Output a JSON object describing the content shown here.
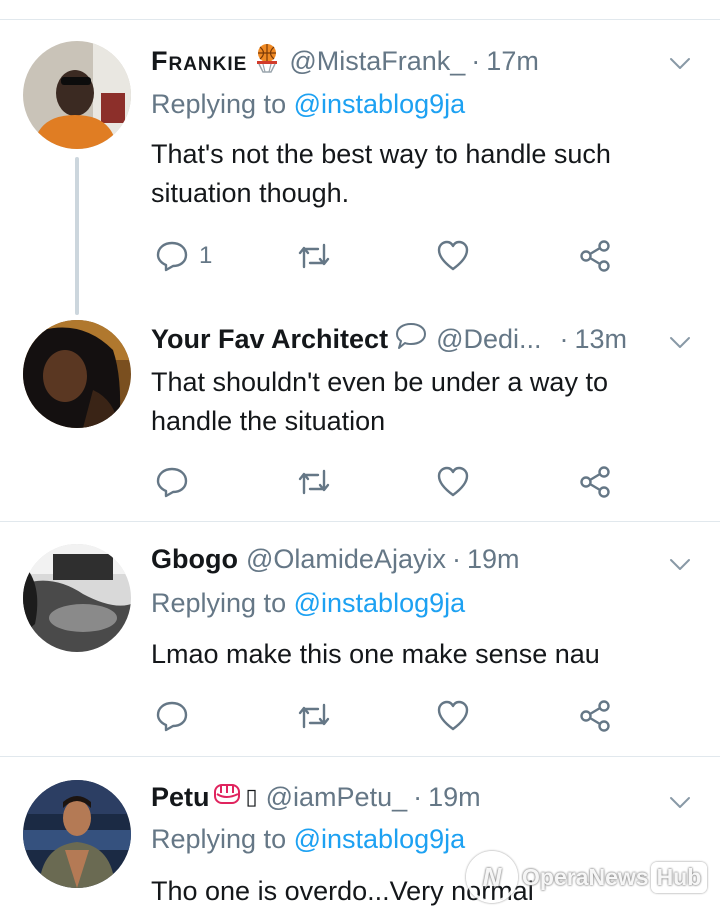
{
  "colors": {
    "text": "#14171a",
    "secondary": "#657786",
    "link": "#1da1f2",
    "divider": "#e1e8ed",
    "thread_line": "#ccd6dd"
  },
  "tweets": [
    {
      "name": "Frankie",
      "badge": "basketball-hoop-emoji",
      "handle": "@MistaFrank_",
      "separator": "·",
      "time": "17m",
      "replying_prefix": "Replying to",
      "replying_handle": "@instablog9ja",
      "text_line1": "That's not the best way to handle such",
      "text_line2": "situation though.",
      "reply_count": "1"
    },
    {
      "name": "Your Fav Architect",
      "badge": "speech-bubble-emoji",
      "handle": "@Dedi...",
      "separator": "·",
      "time": "13m",
      "text_line1": "That shouldn't even be under a way to",
      "text_line2": "handle the situation",
      "reply_count": ""
    },
    {
      "name": "Gbogo",
      "handle": "@OlamideAjayix",
      "separator": "·",
      "time": "19m",
      "replying_prefix": "Replying to",
      "replying_handle": "@instablog9ja",
      "text_line1": "Lmao make this one make sense nau",
      "reply_count": ""
    },
    {
      "name": "Petu",
      "badge": "fist-emoji",
      "badge2": "▯",
      "handle": "@iamPetu_",
      "separator": "·",
      "time": "19m",
      "replying_prefix": "Replying to",
      "replying_handle": "@instablog9ja",
      "text_line1": "Tho one is overdo...Very normal"
    }
  ],
  "watermark": {
    "brand": "OperaNews",
    "hub": "Hub"
  }
}
